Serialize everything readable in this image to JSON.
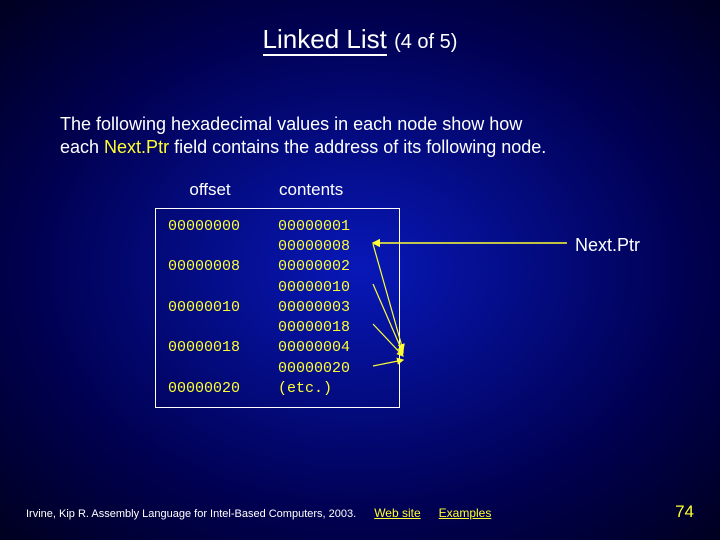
{
  "title": {
    "main": "Linked List",
    "sub": "(4 of 5)"
  },
  "body": {
    "line1": "The following hexadecimal values in each node show how",
    "line2a": "each ",
    "nextptr_term": "Next.Ptr",
    "line2b": " field contains the address of its following node."
  },
  "table": {
    "header_offset": "offset",
    "header_contents": "contents",
    "rows": [
      {
        "offset": "00000000",
        "contents": "00000001"
      },
      {
        "offset": "",
        "contents": "00000008"
      },
      {
        "offset": "00000008",
        "contents": "00000002"
      },
      {
        "offset": "",
        "contents": "00000010"
      },
      {
        "offset": "00000010",
        "contents": "00000003"
      },
      {
        "offset": "",
        "contents": "00000018"
      },
      {
        "offset": "00000018",
        "contents": "00000004"
      },
      {
        "offset": "",
        "contents": "00000020"
      },
      {
        "offset": "00000020",
        "contents": "(etc.)"
      }
    ],
    "label_nextptr": "Next.Ptr"
  },
  "footer": {
    "citation": "Irvine, Kip R. Assembly Language for Intel-Based Computers, 2003.",
    "link_web": "Web site",
    "link_examples": "Examples",
    "page": "74"
  }
}
